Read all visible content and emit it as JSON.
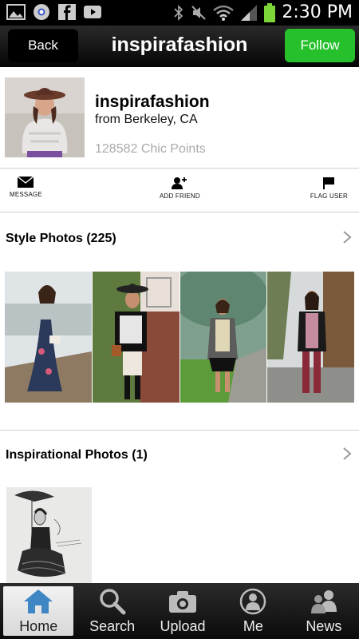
{
  "status_bar": {
    "time": "2:30 PM",
    "left_icons": [
      "gallery-icon",
      "chrome-icon",
      "facebook-icon",
      "youtube-icon"
    ],
    "right_icons": [
      "bluetooth-icon",
      "mute-icon",
      "wifi-icon",
      "signal-icon",
      "battery-icon"
    ]
  },
  "header": {
    "back_label": "Back",
    "title": "inspirafashion",
    "follow_label": "Follow",
    "follow_color": "#25c02b"
  },
  "profile": {
    "name": "inspirafashion",
    "location": "from Berkeley, CA",
    "points": "128582 Chic Points"
  },
  "actions": [
    {
      "label": "MESSAGE",
      "icon": "envelope-icon"
    },
    {
      "label": "ADD FRIEND",
      "icon": "add-friend-icon"
    },
    {
      "label": "FLAG USER",
      "icon": "flag-icon"
    }
  ],
  "style_photos": {
    "title": "Style Photos (225)",
    "count": 4
  },
  "inspirational_photos": {
    "title": "Inspirational Photos (1)",
    "count": 1
  },
  "bottom_nav": [
    {
      "label": "Home",
      "icon": "home-icon",
      "active": true
    },
    {
      "label": "Search",
      "icon": "search-icon",
      "active": false
    },
    {
      "label": "Upload",
      "icon": "camera-icon",
      "active": false
    },
    {
      "label": "Me",
      "icon": "person-icon",
      "active": false
    },
    {
      "label": "News",
      "icon": "people-icon",
      "active": false
    }
  ]
}
